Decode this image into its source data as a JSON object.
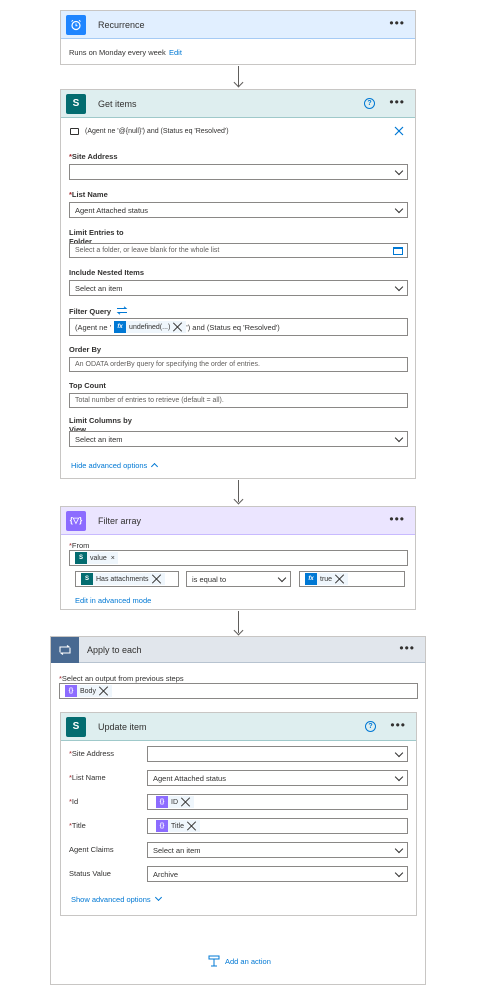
{
  "recurrence": {
    "title": "Recurrence",
    "summary": "Runs on Monday every week",
    "edit_label": "Edit",
    "accent": "#1f85ff",
    "icon": "alarm-clock-icon"
  },
  "get_items": {
    "title": "Get items",
    "accent": "#036c70",
    "header_bg": "#deeeef",
    "icon": "sharepoint-icon",
    "filter_preview": "(Agent ne '@{null}') and (Status eq 'Resolved')",
    "site_address_label": "Site Address",
    "site_address_value": "",
    "list_name_label": "List Name",
    "list_name_value": "Agent Attached status",
    "limit_entries_label_1": "Limit Entries to",
    "limit_entries_label_2": "Folder",
    "limit_entries_placeholder": "Select a folder, or leave blank for the whole list",
    "include_nested_label": "Include Nested Items",
    "include_nested_placeholder": "Select an item",
    "filter_query_label": "Filter Query",
    "filter_query_prefix": "(Agent ne '",
    "filter_query_token": "undefined(...)",
    "filter_query_suffix": "') and (Status eq 'Resolved')",
    "order_by_label": "Order By",
    "order_by_placeholder": "An ODATA orderBy query for specifying the order of entries.",
    "top_count_label": "Top Count",
    "top_count_placeholder": "Total number of entries to retrieve (default = all).",
    "limit_columns_label_1": "Limit Columns by",
    "limit_columns_label_2": "View",
    "limit_columns_placeholder": "Select an item",
    "hide_advanced_label": "Hide advanced options"
  },
  "filter_array": {
    "title": "Filter array",
    "accent": "#8c6cff",
    "header_bg": "#ebe5ff",
    "icon": "filter-array-icon",
    "from_label": "From",
    "from_token": "value",
    "left_token": "Has attachments",
    "operator": "is equal to",
    "right_token": "true",
    "edit_advanced_label": "Edit in advanced mode"
  },
  "apply_to_each": {
    "title": "Apply to each",
    "accent": "#486991",
    "header_bg": "#e1e6ec",
    "icon": "loop-icon",
    "select_output_label": "Select an output from previous steps",
    "select_output_token": "Body"
  },
  "update_item": {
    "title": "Update item",
    "accent": "#036c70",
    "header_bg": "#deeeef",
    "icon": "sharepoint-icon",
    "site_address_label": "Site Address",
    "site_address_value": "",
    "list_name_label": "List Name",
    "list_name_value": "Agent Attached status",
    "id_label": "Id",
    "id_token": "ID",
    "title_label": "Title",
    "title_token": "Title",
    "agent_claims_label": "Agent Claims",
    "agent_claims_placeholder": "Select an item",
    "status_value_label": "Status Value",
    "status_value_value": "Archive",
    "show_advanced_label": "Show advanced options"
  },
  "add_action_label": "Add an action",
  "fx_label": "fx"
}
